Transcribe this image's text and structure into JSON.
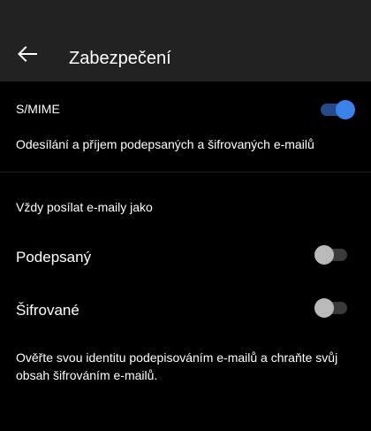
{
  "header": {
    "title": "Zabezpečení",
    "back_icon": "arrow-left-icon"
  },
  "smime": {
    "label": "S/MIME",
    "description": "Odesílání a příjem podepsaných a šifrovaných e-mailů",
    "enabled": true
  },
  "always_send": {
    "header": "Vždy posílat e-maily jako",
    "signed": {
      "label": "Podepsaný",
      "enabled": false
    },
    "encrypted": {
      "label": "Šifrované",
      "enabled": false
    }
  },
  "footer": {
    "note": "Ověřte svou identitu podepisováním e-mailů a chraňte svůj obsah šifrováním e-mailů."
  },
  "colors": {
    "background": "#000000",
    "app_bar": "#222222",
    "toggle_on_track": "#234b8a",
    "toggle_on_knob": "#3b82e8",
    "toggle_off_track": "#3a3a3a",
    "toggle_off_knob": "#b9b9b9"
  }
}
